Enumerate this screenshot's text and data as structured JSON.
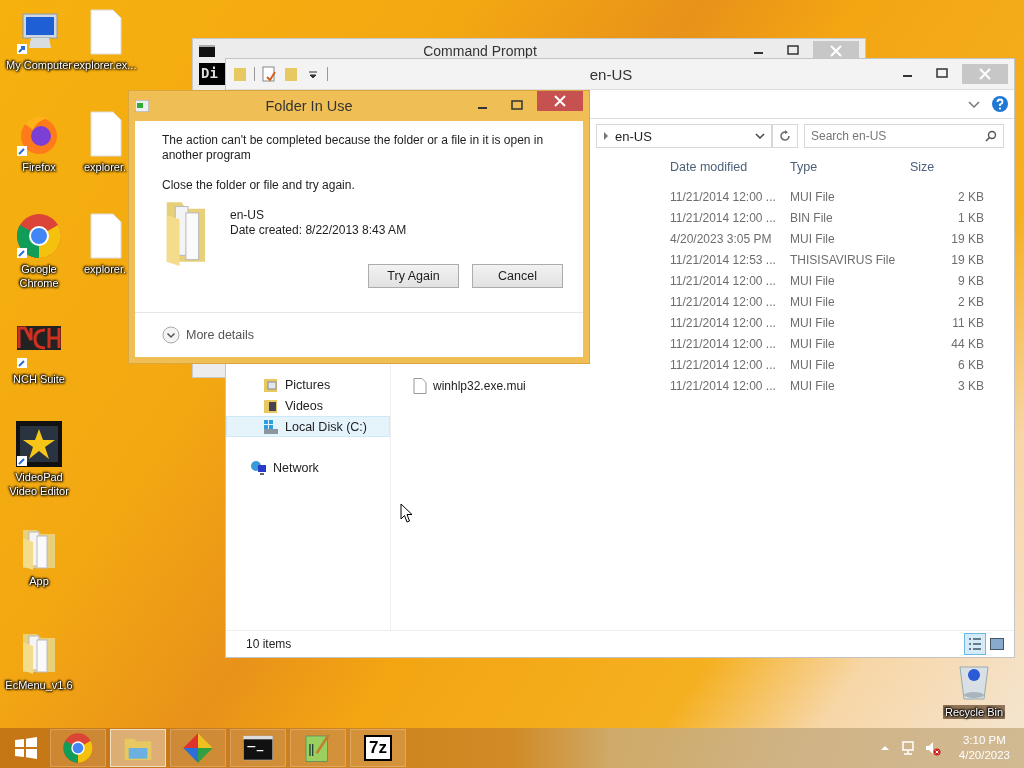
{
  "desktop_icons": [
    {
      "label": "My Computer",
      "kind": "computer"
    },
    {
      "label": "explorer.ex...",
      "kind": "file"
    },
    {
      "label": "Firefox",
      "kind": "firefox"
    },
    {
      "label": "explorer.",
      "kind": "file"
    },
    {
      "label": "Google Chrome",
      "kind": "chrome"
    },
    {
      "label": "explorer.",
      "kind": "file"
    },
    {
      "label": "NCH Suite",
      "kind": "nch"
    },
    {
      "label": "VideoPad Video Editor",
      "kind": "videopad"
    },
    {
      "label": "App",
      "kind": "folder"
    },
    {
      "label": "EcMenu_v1.6",
      "kind": "folder"
    },
    {
      "label": "Recycle Bin",
      "kind": "recycle"
    }
  ],
  "cmd_window": {
    "title": "Command Prompt",
    "console_text": "Di"
  },
  "explorer": {
    "title": "en-US",
    "address": "en-US",
    "search_placeholder": "Search en-US",
    "columns": [
      "Date modified",
      "Type",
      "Size"
    ],
    "rows": [
      {
        "date": "11/21/2014 12:00 ...",
        "type": "MUI File",
        "size": "2 KB"
      },
      {
        "date": "11/21/2014 12:00 ...",
        "type": "BIN File",
        "size": "1 KB"
      },
      {
        "date": "4/20/2023 3:05 PM",
        "type": "MUI File",
        "size": "19 KB"
      },
      {
        "date": "11/21/2014 12:53 ...",
        "type": "THISISAVIRUS File",
        "size": "19 KB"
      },
      {
        "date": "11/21/2014 12:00 ...",
        "type": "MUI File",
        "size": "9 KB"
      },
      {
        "date": "11/21/2014 12:00 ...",
        "type": "MUI File",
        "size": "2 KB"
      },
      {
        "date": "11/21/2014 12:00 ...",
        "type": "MUI File",
        "size": "11 KB"
      },
      {
        "date": "11/21/2014 12:00 ...",
        "type": "MUI File",
        "size": "44 KB"
      },
      {
        "date": "11/21/2014 12:00 ...",
        "type": "MUI File",
        "size": "6 KB"
      },
      {
        "name": "winhlp32.exe.mui",
        "date": "11/21/2014 12:00 ...",
        "type": "MUI File",
        "size": "3 KB"
      }
    ],
    "nav_items": [
      {
        "label": "Pictures",
        "kind": "pictures",
        "selected": false
      },
      {
        "label": "Videos",
        "kind": "videos",
        "selected": false
      },
      {
        "label": "Local Disk (C:)",
        "kind": "disk",
        "selected": true
      },
      {
        "label": "Network",
        "kind": "network",
        "selected": false
      }
    ],
    "status": "10 items",
    "views": [
      {
        "kind": "details",
        "selected": true
      },
      {
        "kind": "large-icons",
        "selected": false
      }
    ]
  },
  "dialog": {
    "title": "Folder In Use",
    "message": "The action can't be completed because the folder or a file in it is open in another program",
    "instruction": "Close the folder or file and try again.",
    "item_name": "en-US",
    "item_date": "Date created: 8/22/2013 8:43 AM",
    "buttons": [
      "Try Again",
      "Cancel"
    ],
    "more_details": "More details"
  },
  "taskbar": {
    "apps": [
      {
        "kind": "chrome",
        "active": false
      },
      {
        "kind": "explorer",
        "active": true
      },
      {
        "kind": "diamond",
        "active": false
      },
      {
        "kind": "cmd",
        "active": false
      },
      {
        "kind": "notepad",
        "active": false
      },
      {
        "kind": "sevenzip",
        "label": "7z",
        "active": false
      }
    ],
    "time": "3:10 PM",
    "date": "4/20/2023"
  }
}
